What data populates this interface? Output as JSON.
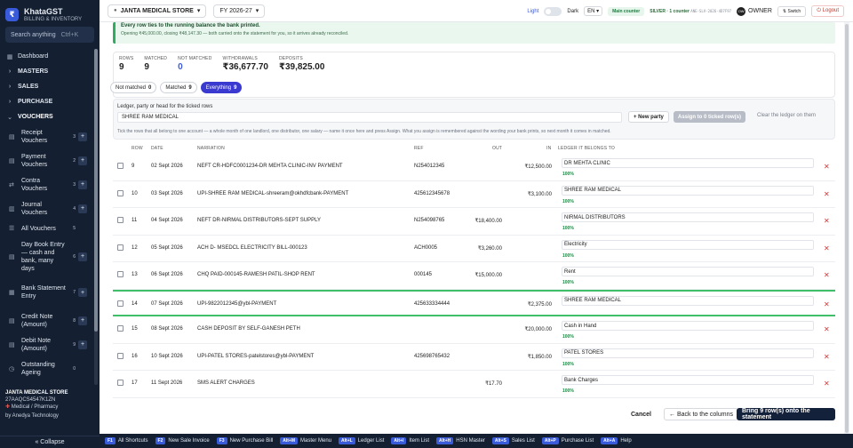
{
  "brand": {
    "name": "KhataGST",
    "sub": "BILLING & INVENTORY",
    "logo": "₹"
  },
  "search": {
    "placeholder": "Search anything",
    "shortcut": "Ctrl+K"
  },
  "nav": {
    "dashboard": "Dashboard",
    "masters": "MASTERS",
    "sales": "SALES",
    "purchase": "PURCHASE",
    "vouchers": "VOUCHERS",
    "voucher_items": [
      {
        "label": "Receipt Vouchers",
        "count": "3"
      },
      {
        "label": "Payment Vouchers",
        "count": "2"
      },
      {
        "label": "Contra Vouchers",
        "count": "3"
      },
      {
        "label": "Journal Vouchers",
        "count": "4"
      },
      {
        "label": "All Vouchers",
        "count": "5"
      },
      {
        "label": "Day Book Entry — cash and bank, many days",
        "count": "6"
      },
      {
        "label": "Bank Statement Entry",
        "count": "7"
      },
      {
        "label": "Credit Note (Amount)",
        "count": "8"
      },
      {
        "label": "Debit Note (Amount)",
        "count": "9"
      },
      {
        "label": "Outstanding Ageing",
        "count": "0"
      }
    ]
  },
  "company": {
    "name": "JANTA MEDICAL STORE",
    "gstin": "27AAQCS4547K1ZN",
    "type": "Medical / Pharmacy",
    "footer": "by Anedya Technology"
  },
  "collapse_label": "« Collapse",
  "topbar": {
    "firm": "JANTA MEDICAL STORE",
    "fy": "FY 2026-27",
    "theme_light": "Light",
    "theme_dark": "Dark",
    "lang": "EN",
    "main_counter": "Main counter",
    "license": "SILVER · 1 counter",
    "license_code": "ANE-SLV-2026-4D7F97",
    "owner": "OWNER",
    "owner_avatar": "OW",
    "switch": "Switch",
    "logout": "Logout"
  },
  "banner": {
    "title": "Every row ties to the running balance the bank printed.",
    "sub": "Opening ₹45,000.00, closing ₹48,147.30 — both carried onto the statement for you, so it arrives already reconciled."
  },
  "stats": [
    {
      "label": "ROWS",
      "value": "9",
      "blue": false
    },
    {
      "label": "MATCHED",
      "value": "9",
      "blue": false
    },
    {
      "label": "NOT MATCHED",
      "value": "0",
      "blue": true
    },
    {
      "label": "WITHDRAWALS",
      "value": "₹36,677.70",
      "blue": false
    },
    {
      "label": "DEPOSITS",
      "value": "₹39,825.00",
      "blue": false
    }
  ],
  "filters": [
    {
      "label": "Not matched",
      "count": "0",
      "active": false
    },
    {
      "label": "Matched",
      "count": "9",
      "active": false
    },
    {
      "label": "Everything",
      "count": "9",
      "active": true
    }
  ],
  "assign": {
    "label": "Ledger, party or head for the ticked rows",
    "value": "SHREE RAM MEDICAL",
    "new_party": "+ New party",
    "assign_btn": "Assign to 0 ticked row(s)",
    "clear": "Clear the ledger on them",
    "hint": "Tick the rows that all belong to one account — a whole month of one landlord, one distributor, one salary — name it once here and press Assign. What you assign is remembered against the wording your bank prints, so next month it comes in matched."
  },
  "columns": {
    "row": "ROW",
    "date": "DATE",
    "narration": "NARRATION",
    "ref": "REF",
    "out": "OUT",
    "in": "IN",
    "ledger": "LEDGER IT BELONGS TO"
  },
  "rows": [
    {
      "row": "9",
      "date": "02 Sept 2026",
      "narration": "NEFT CR-HDFC0001234-DR MEHTA CLINIC-INV PAYMENT",
      "ref": "N254012345",
      "out": "",
      "in": "₹12,500.00",
      "ledger": "DR MEHTA CLINIC",
      "pct": "100%",
      "hl": false
    },
    {
      "row": "10",
      "date": "03 Sept 2026",
      "narration": "UPI-SHREE RAM MEDICAL-shreeram@okhdfcbank-PAYMENT",
      "ref": "425612345678",
      "out": "",
      "in": "₹3,100.00",
      "ledger": "SHREE RAM MEDICAL",
      "pct": "100%",
      "hl": false
    },
    {
      "row": "11",
      "date": "04 Sept 2026",
      "narration": "NEFT DR-NIRMAL DISTRIBUTORS-SEPT SUPPLY",
      "ref": "N254098765",
      "out": "₹18,400.00",
      "in": "",
      "ledger": "NIRMAL DISTRIBUTORS",
      "pct": "100%",
      "hl": false
    },
    {
      "row": "12",
      "date": "05 Sept 2026",
      "narration": "ACH D- MSEDCL ELECTRICITY BILL-000123",
      "ref": "ACH0005",
      "out": "₹3,260.00",
      "in": "",
      "ledger": "Electricity",
      "pct": "100%",
      "hl": false
    },
    {
      "row": "13",
      "date": "06 Sept 2026",
      "narration": "CHQ PAID-000145-RAMESH PATIL-SHOP RENT",
      "ref": "000145",
      "out": "₹15,000.00",
      "in": "",
      "ledger": "Rent",
      "pct": "100%",
      "hl": false
    },
    {
      "row": "14",
      "date": "07 Sept 2026",
      "narration": "UPI-9822012345@ybl-PAYMENT",
      "ref": "425633334444",
      "out": "",
      "in": "₹2,375.00",
      "ledger": "SHREE RAM MEDICAL",
      "pct": "",
      "hl": true
    },
    {
      "row": "15",
      "date": "08 Sept 2026",
      "narration": "CASH DEPOSIT BY SELF-GANESH PETH",
      "ref": "",
      "out": "",
      "in": "₹20,000.00",
      "ledger": "Cash in Hand",
      "pct": "100%",
      "hl": false
    },
    {
      "row": "16",
      "date": "10 Sept 2026",
      "narration": "UPI-PATEL STORES-patelstores@ybl-PAYMENT",
      "ref": "425698765432",
      "out": "",
      "in": "₹1,850.00",
      "ledger": "PATEL STORES",
      "pct": "100%",
      "hl": false
    },
    {
      "row": "17",
      "date": "11 Sept 2026",
      "narration": "SMS ALERT CHARGES",
      "ref": "",
      "out": "₹17.70",
      "in": "",
      "ledger": "Bank Charges",
      "pct": "100%",
      "hl": false
    }
  ],
  "actions": {
    "cancel": "Cancel",
    "back": "← Back to the columns",
    "bring": "Bring 9 row(s) onto the statement"
  },
  "shortcuts": [
    {
      "key": "F1",
      "label": "All Shortcuts"
    },
    {
      "key": "F2",
      "label": "New Sale Invoice"
    },
    {
      "key": "F3",
      "label": "New Purchase Bill"
    },
    {
      "key": "Alt+M",
      "label": "Master Menu"
    },
    {
      "key": "Alt+L",
      "label": "Ledger List"
    },
    {
      "key": "Alt+I",
      "label": "Item List"
    },
    {
      "key": "Alt+H",
      "label": "HSN Master"
    },
    {
      "key": "Alt+S",
      "label": "Sales List"
    },
    {
      "key": "Alt+P",
      "label": "Purchase List"
    },
    {
      "key": "Alt+A",
      "label": "Help"
    }
  ],
  "colors": {
    "sidebar": "#142032",
    "accent": "#3a5bd9",
    "match": "#3fbf6a"
  }
}
